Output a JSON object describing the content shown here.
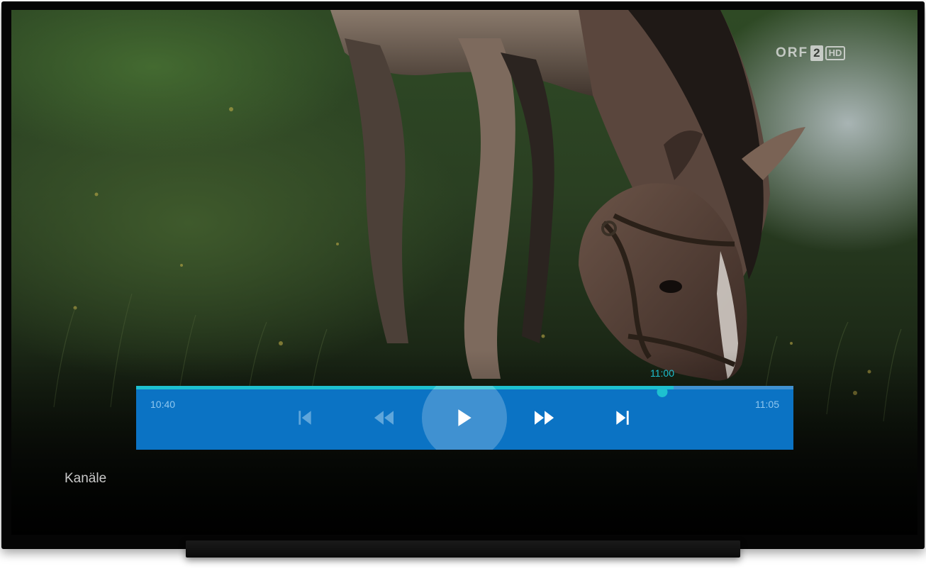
{
  "channel_logo": {
    "brand": "ORF",
    "number": "2",
    "badge": "HD"
  },
  "player": {
    "start_time": "10:40",
    "end_time": "11:05",
    "scrub_time": "11:00",
    "progress_fraction": 0.8,
    "controls": [
      {
        "name": "skip-previous",
        "icon": "skip-previous-icon",
        "enabled": false
      },
      {
        "name": "rewind",
        "icon": "rewind-icon",
        "enabled": false
      },
      {
        "name": "play",
        "icon": "play-icon",
        "enabled": true,
        "focused": true
      },
      {
        "name": "fast-forward",
        "icon": "fast-forward-icon",
        "enabled": true
      },
      {
        "name": "skip-next",
        "icon": "skip-next-icon",
        "enabled": true
      }
    ],
    "colors": {
      "bar": "#0b73c4",
      "accent": "#1ec0d0"
    }
  },
  "channels_label": "Kanäle"
}
